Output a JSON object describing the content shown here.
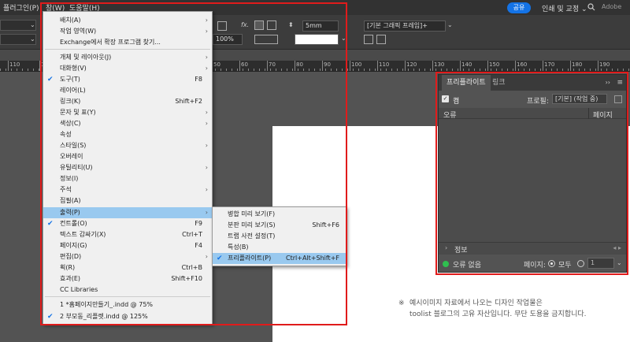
{
  "menubar": {
    "plugin": "플러그인(P)",
    "window": "창(W)",
    "help": "도움말(H)",
    "share": "공유",
    "print_fixed": "인쇄 및 교정 ⌄",
    "adobe": "Adobe"
  },
  "control": {
    "stroke_value": "5mm",
    "zoom_value": "100%",
    "frame_style": "[기본 그래픽 프레임]+",
    "fx": "fx."
  },
  "ruler": {
    "labels": [
      "110",
      "100",
      "0",
      "10",
      "20",
      "30",
      "40",
      "50",
      "60",
      "70",
      "80",
      "90",
      "100",
      "110",
      "120",
      "130",
      "140",
      "150",
      "160",
      "170",
      "180",
      "190"
    ]
  },
  "window_menu": {
    "items": [
      {
        "label": "배치(A)",
        "shortcut": "",
        "arrow": true,
        "check": false
      },
      {
        "label": "작업 영역(W)",
        "shortcut": "",
        "arrow": true,
        "check": false
      },
      {
        "label": "Exchange에서 확장 프로그램 찾기...",
        "shortcut": "",
        "arrow": false,
        "check": false
      },
      {
        "label": "개체 및 레이아웃(J)",
        "shortcut": "",
        "arrow": true,
        "check": false
      },
      {
        "label": "대화형(V)",
        "shortcut": "",
        "arrow": true,
        "check": false
      },
      {
        "label": "도구(T)",
        "shortcut": "F8",
        "arrow": false,
        "check": true
      },
      {
        "label": "레이어(L)",
        "shortcut": "",
        "arrow": false,
        "check": false
      },
      {
        "label": "링크(K)",
        "shortcut": "Shift+F2",
        "arrow": false,
        "check": false
      },
      {
        "label": "문자 및 표(Y)",
        "shortcut": "",
        "arrow": true,
        "check": false
      },
      {
        "label": "색상(C)",
        "shortcut": "",
        "arrow": true,
        "check": false
      },
      {
        "label": "속성",
        "shortcut": "",
        "arrow": false,
        "check": false
      },
      {
        "label": "스타일(S)",
        "shortcut": "",
        "arrow": true,
        "check": false
      },
      {
        "label": "오버레이",
        "shortcut": "",
        "arrow": false,
        "check": false
      },
      {
        "label": "유틸리티(U)",
        "shortcut": "",
        "arrow": true,
        "check": false
      },
      {
        "label": "정보(I)",
        "shortcut": "",
        "arrow": false,
        "check": false
      },
      {
        "label": "주석",
        "shortcut": "",
        "arrow": true,
        "check": false
      },
      {
        "label": "집필(A)",
        "shortcut": "",
        "arrow": false,
        "check": false
      },
      {
        "label": "출력(P)",
        "shortcut": "",
        "arrow": true,
        "check": false,
        "highlight": true
      },
      {
        "label": "컨트롤(O)",
        "shortcut": "F9",
        "arrow": false,
        "check": true
      },
      {
        "label": "텍스트 감싸기(X)",
        "shortcut": "Ctrl+T",
        "arrow": false,
        "check": false
      },
      {
        "label": "페이지(G)",
        "shortcut": "F4",
        "arrow": false,
        "check": false
      },
      {
        "label": "편집(D)",
        "shortcut": "",
        "arrow": true,
        "check": false
      },
      {
        "label": "획(R)",
        "shortcut": "Ctrl+B",
        "arrow": false,
        "check": false
      },
      {
        "label": "효과(E)",
        "shortcut": "Shift+F10",
        "arrow": false,
        "check": false
      },
      {
        "label": "CC Libraries",
        "shortcut": "",
        "arrow": false,
        "check": false
      },
      {
        "label": "1 *홈페이지만들기_.indd @ 75%",
        "shortcut": "",
        "arrow": false,
        "check": false
      },
      {
        "label": "2 부모동_리플렛.indd @ 125%",
        "shortcut": "",
        "arrow": false,
        "check": true
      }
    ]
  },
  "output_submenu": {
    "items": [
      {
        "label": "병합 미리 보기(F)",
        "shortcut": ""
      },
      {
        "label": "분판 미리 보기(S)",
        "shortcut": "Shift+F6"
      },
      {
        "label": "트랩 사전 설정(T)",
        "shortcut": ""
      },
      {
        "label": "특성(B)",
        "shortcut": ""
      },
      {
        "label": "프리플라이트(P)",
        "shortcut": "Ctrl+Alt+Shift+F",
        "check": true,
        "highlight": true
      }
    ]
  },
  "preflight": {
    "tab_active": "프리플라이트",
    "tab_link": "링크",
    "on_label": "켬",
    "profile_label": "프로필:",
    "profile_value": "[기본] (작업 중)",
    "col_error": "오류",
    "col_page": "페이지",
    "info_label": "정보",
    "status": "오류 없음",
    "pages_label": "페이지:",
    "all_label": "모두",
    "range_value": "1"
  },
  "notice": {
    "mark": "※",
    "line1": "예시이미지 자료에서 나오는 디자인 작업물은",
    "line2": "toolist 블로그의 고유 자산입니다. 무단 도용을 금지합니다."
  },
  "colors": {
    "highlight": "#99c9ef",
    "share": "#1473e6",
    "annotation_red": "#e01b1b",
    "status_green": "#2fbf4f"
  }
}
